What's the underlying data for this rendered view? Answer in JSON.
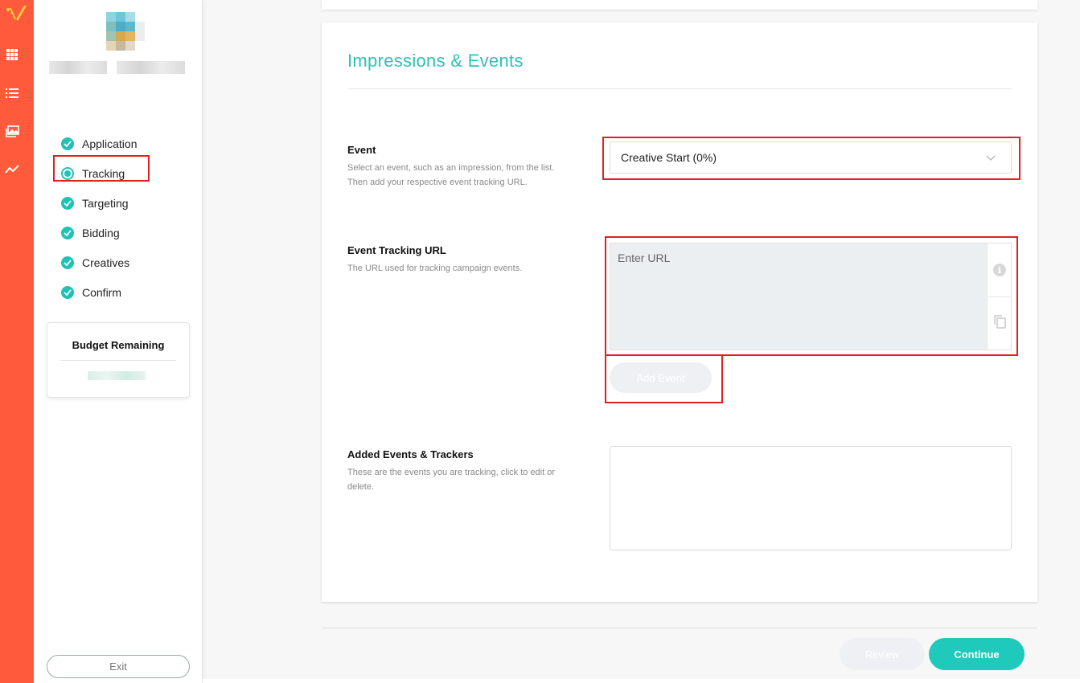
{
  "colors": {
    "rail": "#ff5a3c",
    "accent": "#1fc2b4",
    "highlight": "#e02020"
  },
  "rail": {
    "icons": [
      "logo-icon",
      "grid-icon",
      "list-icon",
      "image-icon",
      "analytics-icon"
    ]
  },
  "sidebar": {
    "steps": [
      {
        "label": "Application",
        "state": "done"
      },
      {
        "label": "Tracking",
        "state": "current"
      },
      {
        "label": "Targeting",
        "state": "done"
      },
      {
        "label": "Bidding",
        "state": "done"
      },
      {
        "label": "Creatives",
        "state": "done"
      },
      {
        "label": "Confirm",
        "state": "done"
      }
    ],
    "budget_title": "Budget Remaining",
    "exit_label": "Exit"
  },
  "main": {
    "title": "Impressions & Events",
    "event": {
      "label": "Event",
      "help": "Select an event, such as an impression, from the list. Then add your respective event tracking URL.",
      "selected": "Creative Start (0%)"
    },
    "tracking_url": {
      "label": "Event Tracking URL",
      "help": "The URL used for tracking campaign events.",
      "placeholder": "Enter URL",
      "value": ""
    },
    "add_event_label": "Add Event",
    "added": {
      "label": "Added Events & Trackers",
      "help": "These are the events you are tracking, click to edit or delete."
    }
  },
  "footer": {
    "review_label": "Review",
    "continue_label": "Continue"
  }
}
